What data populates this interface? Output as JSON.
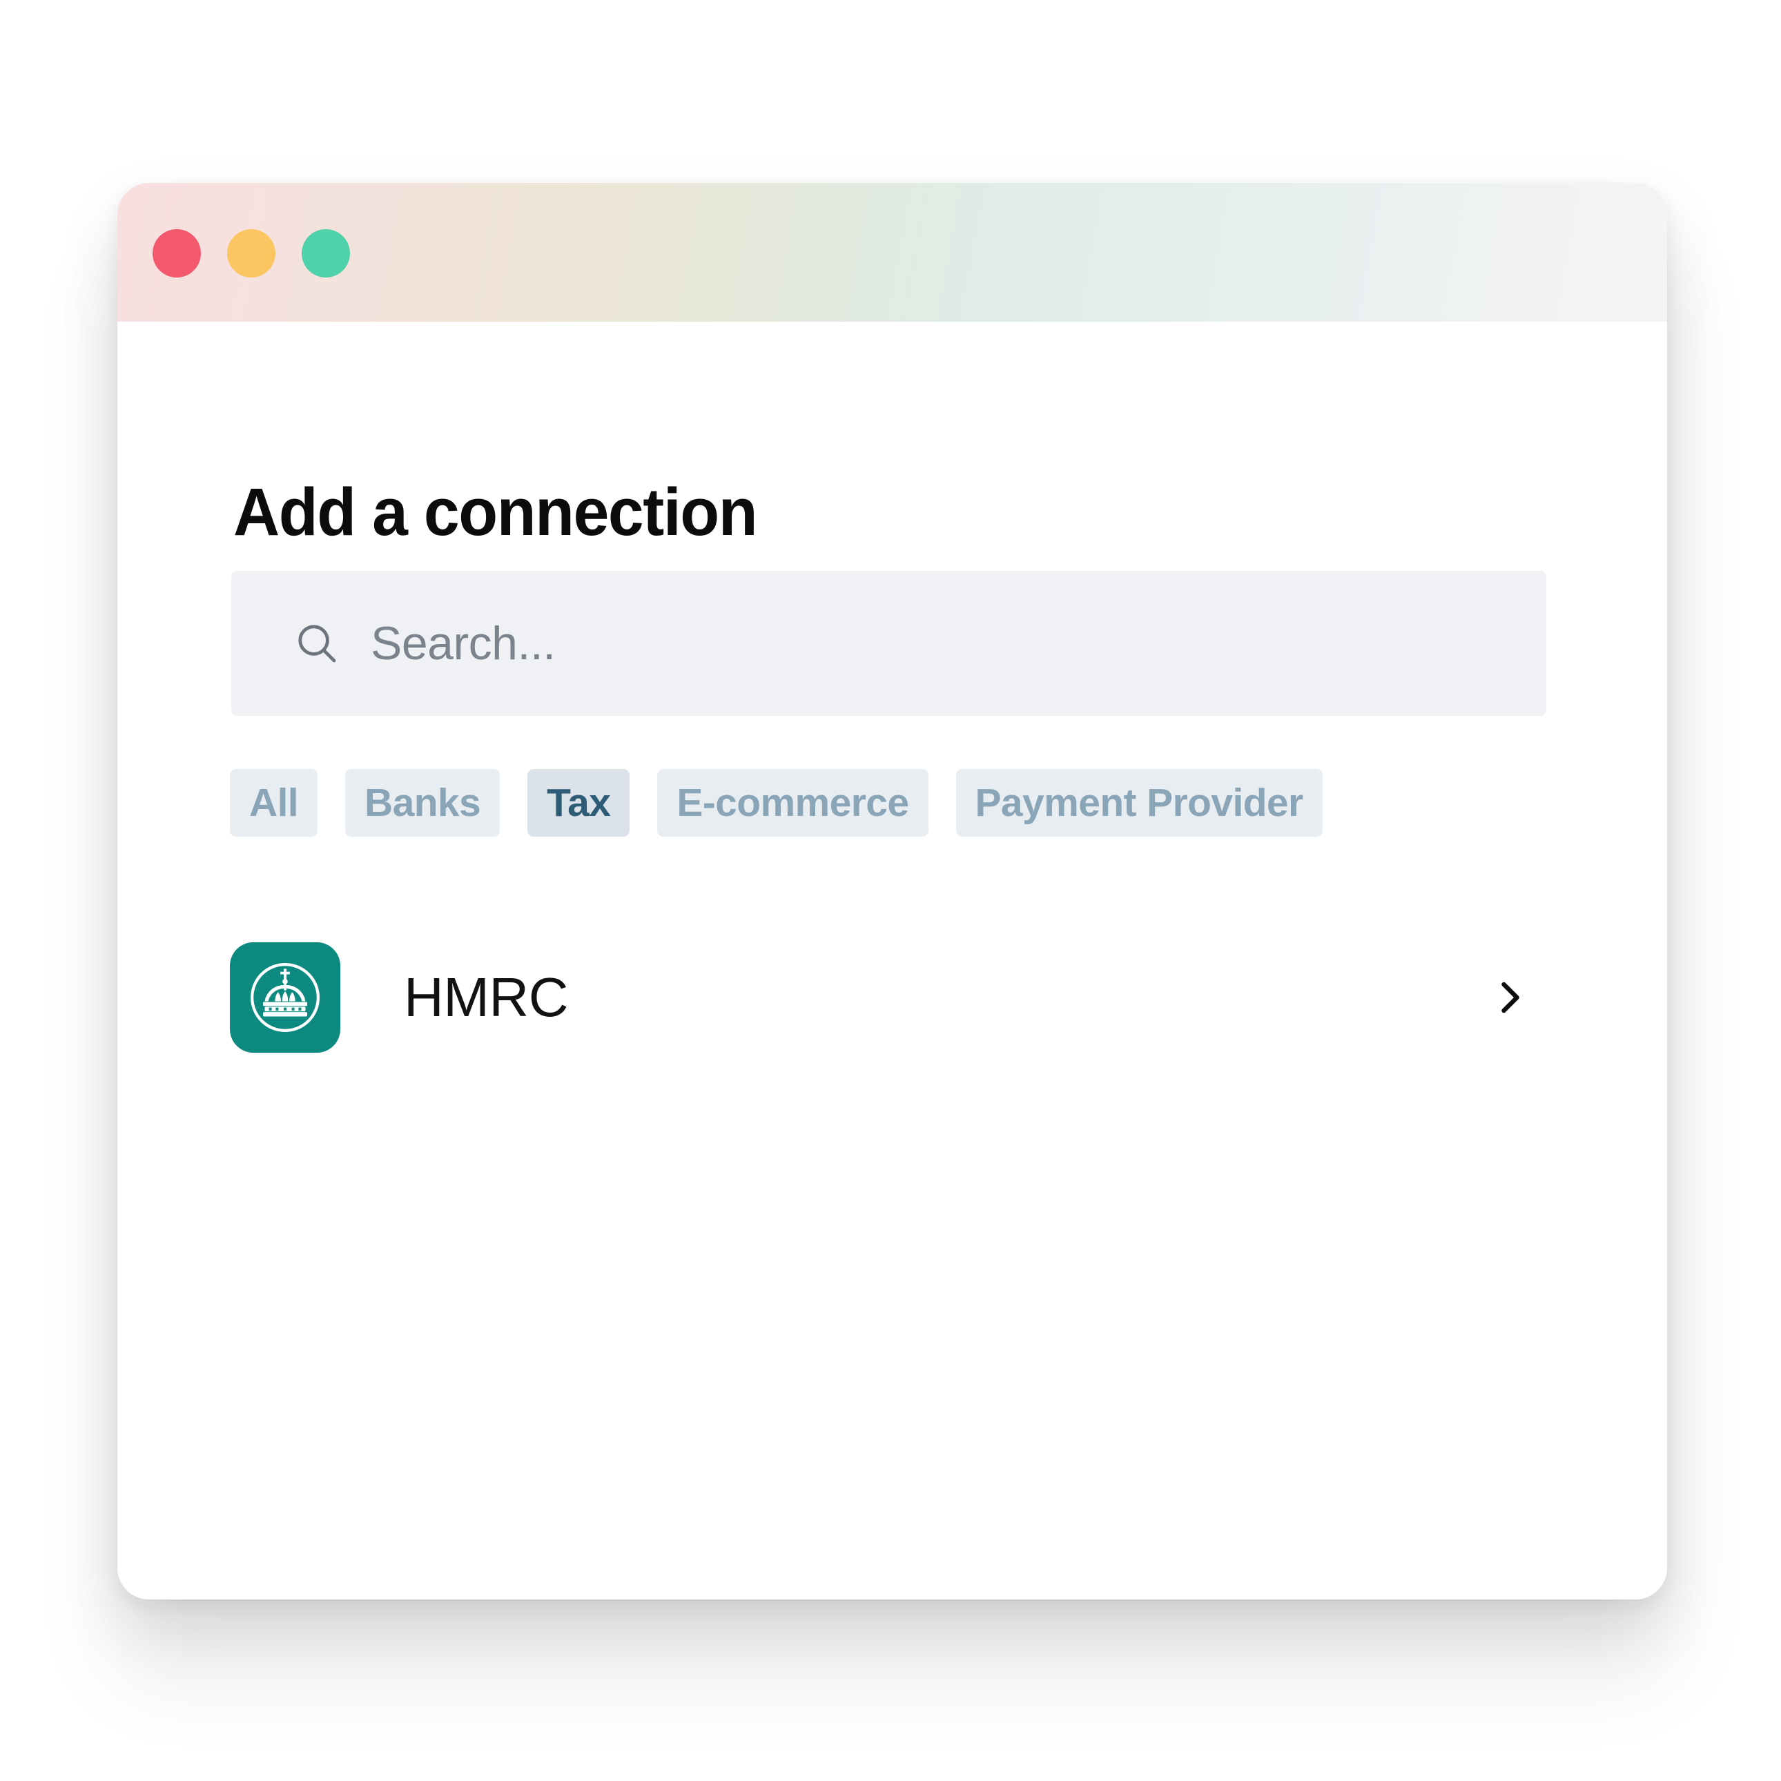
{
  "window": {
    "traffic_lights": [
      {
        "name": "close",
        "color": "#f3596d"
      },
      {
        "name": "minimize",
        "color": "#fbc662"
      },
      {
        "name": "maximize",
        "color": "#4fd2a9"
      }
    ]
  },
  "page": {
    "title": "Add a connection"
  },
  "search": {
    "icon": "search-icon",
    "value": "",
    "placeholder": "Search..."
  },
  "filters": {
    "selected": "Tax",
    "chips": [
      {
        "label": "All",
        "selected": false
      },
      {
        "label": "Banks",
        "selected": false
      },
      {
        "label": "Tax",
        "selected": true
      },
      {
        "label": "E-commerce",
        "selected": false
      },
      {
        "label": "Payment Provider",
        "selected": false
      }
    ]
  },
  "connections": {
    "items": [
      {
        "name": "HMRC",
        "logo_icon": "hmrc-crown-icon",
        "logo_color": "#0d8a80",
        "chevron_icon": "chevron-right-icon"
      }
    ]
  },
  "colors": {
    "accent_teal": "#0d8a80",
    "chip_bg": "#e8edf2",
    "chip_text": "#8ba5b8",
    "chip_selected_bg": "#dce2e9",
    "chip_selected_text": "#2e5b76",
    "search_bg": "#eff1f4",
    "search_text": "#7b848d",
    "title_text": "#0a0c0e",
    "window_bg": "#ffffff"
  }
}
